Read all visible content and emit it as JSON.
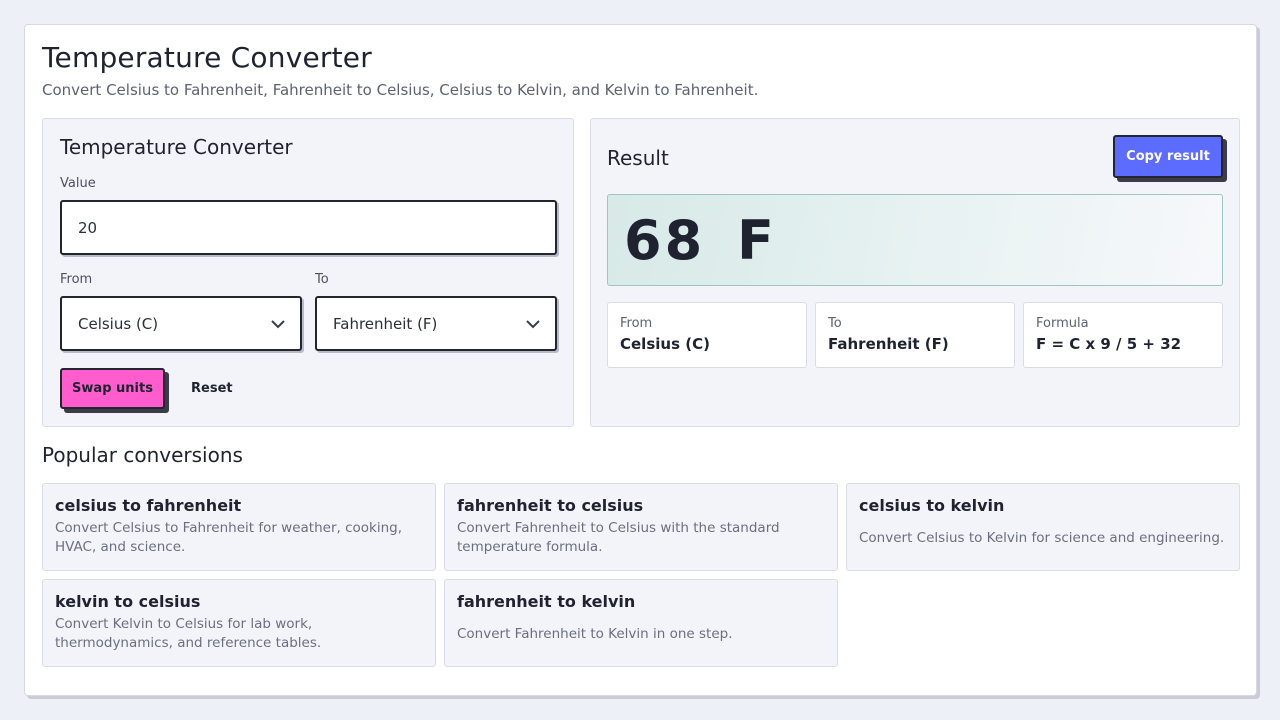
{
  "header": {
    "title": "Temperature Converter",
    "subtitle": "Convert Celsius to Fahrenheit, Fahrenheit to Celsius, Celsius to Kelvin, and Kelvin to Fahrenheit."
  },
  "converter": {
    "title": "Temperature Converter",
    "value_label": "Value",
    "value": "20",
    "from_label": "From",
    "from_value": "Celsius (C)",
    "to_label": "To",
    "to_value": "Fahrenheit (F)",
    "swap_label": "Swap units",
    "reset_label": "Reset"
  },
  "result": {
    "title": "Result",
    "copy_label": "Copy result",
    "value": "68 F",
    "from_label": "From",
    "from_value": "Celsius (C)",
    "to_label": "To",
    "to_value": "Fahrenheit (F)",
    "formula_label": "Formula",
    "formula_value": "F = C x 9 / 5 + 32"
  },
  "popular": {
    "title": "Popular conversions",
    "items": [
      {
        "title": "celsius to fahrenheit",
        "desc": "Convert Celsius to Fahrenheit for weather, cooking, HVAC, and science."
      },
      {
        "title": "fahrenheit to celsius",
        "desc": "Convert Fahrenheit to Celsius with the standard temperature formula."
      },
      {
        "title": "celsius to kelvin",
        "desc": "Convert Celsius to Kelvin for science and engineering."
      },
      {
        "title": "kelvin to celsius",
        "desc": "Convert Kelvin to Celsius for lab work, thermodynamics, and reference tables."
      },
      {
        "title": "fahrenheit to kelvin",
        "desc": "Convert Fahrenheit to Kelvin in one step."
      }
    ]
  },
  "colors": {
    "swap_button": "#ff5ccd",
    "copy_button": "#5b6cff",
    "result_border": "#9cc6c4"
  }
}
